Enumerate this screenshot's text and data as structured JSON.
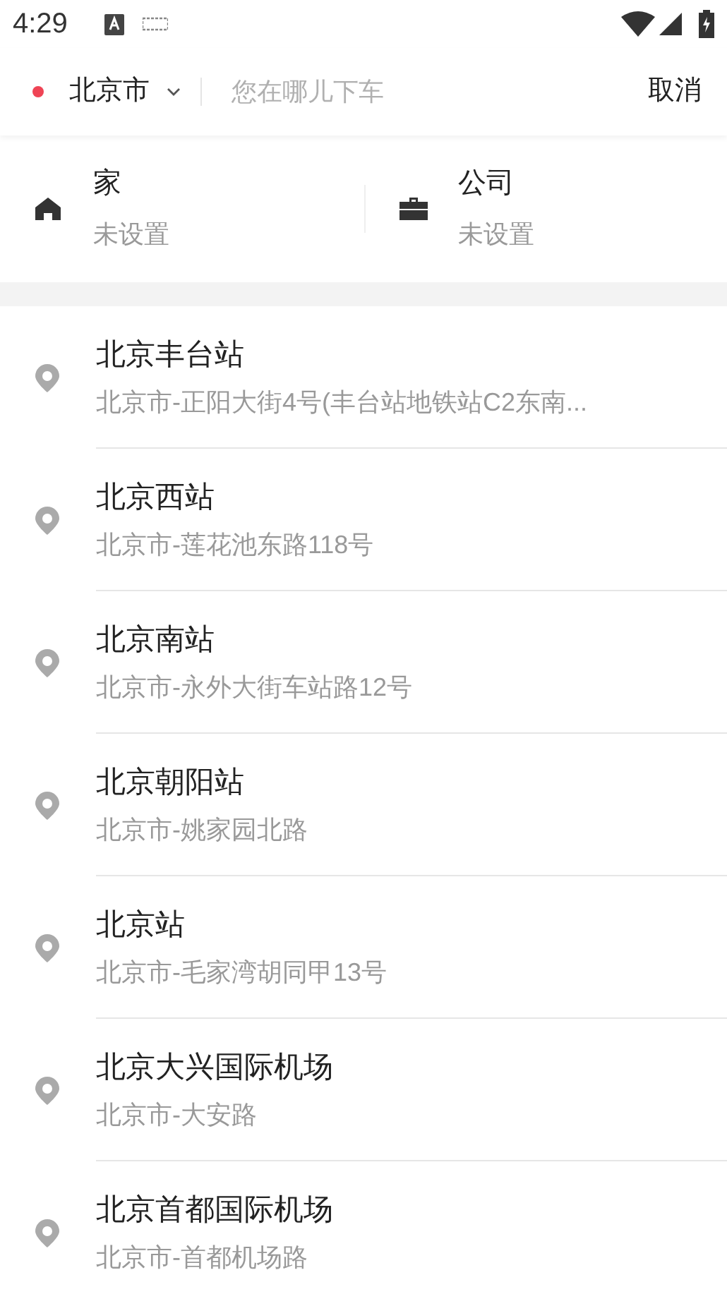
{
  "status_bar": {
    "time": "4:29"
  },
  "search": {
    "city": "北京市",
    "placeholder": "您在哪儿下车",
    "cancel": "取消"
  },
  "shortcuts": [
    {
      "kind": "home",
      "label": "家",
      "value": "未设置"
    },
    {
      "kind": "work",
      "label": "公司",
      "value": "未设置"
    }
  ],
  "places": [
    {
      "name": "北京丰台站",
      "address": "北京市-正阳大街4号(丰台站地铁站C2东南..."
    },
    {
      "name": "北京西站",
      "address": "北京市-莲花池东路118号"
    },
    {
      "name": "北京南站",
      "address": "北京市-永外大街车站路12号"
    },
    {
      "name": "北京朝阳站",
      "address": "北京市-姚家园北路"
    },
    {
      "name": "北京站",
      "address": "北京市-毛家湾胡同甲13号"
    },
    {
      "name": "北京大兴国际机场",
      "address": "北京市-大安路"
    },
    {
      "name": "北京首都国际机场",
      "address": "北京市-首都机场路"
    }
  ]
}
